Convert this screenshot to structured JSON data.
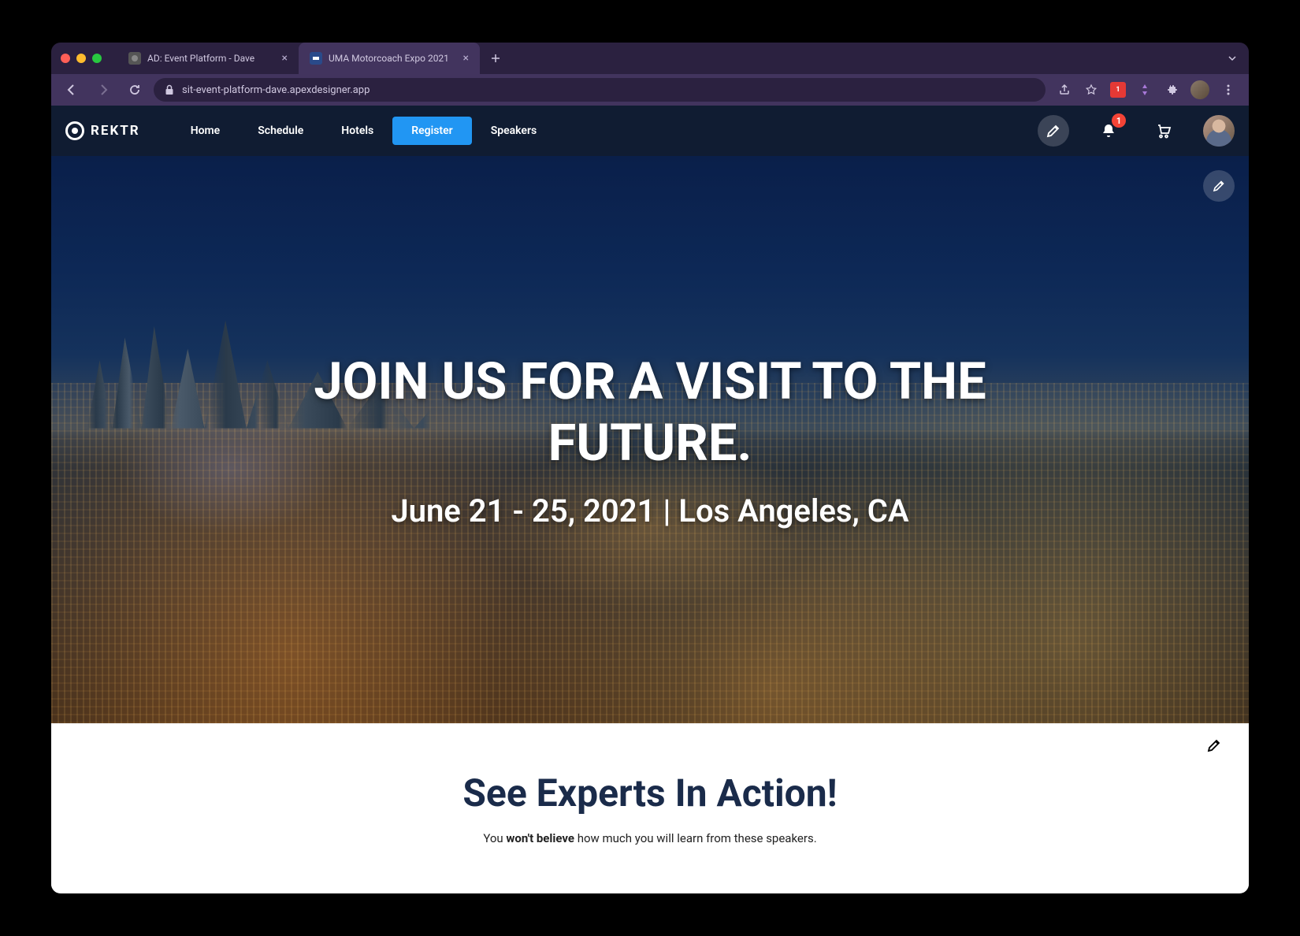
{
  "browser": {
    "tabs": [
      {
        "title": "AD: Event Platform - Dave",
        "active": false
      },
      {
        "title": "UMA Motorcoach Expo 2021",
        "active": true
      }
    ],
    "url": "sit-event-platform-dave.apexdesigner.app",
    "ext_badge": "1"
  },
  "nav": {
    "logo": "REKTR",
    "links": [
      {
        "label": "Home",
        "primary": false
      },
      {
        "label": "Schedule",
        "primary": false
      },
      {
        "label": "Hotels",
        "primary": false
      },
      {
        "label": "Register",
        "primary": true
      },
      {
        "label": "Speakers",
        "primary": false
      }
    ],
    "notif_count": "1"
  },
  "hero": {
    "title": "JOIN US FOR A VISIT TO THE FUTURE.",
    "subtitle": "June 21 - 25, 2021 | Los Angeles, CA"
  },
  "section": {
    "heading": "See Experts In Action!",
    "sub_pre": "You ",
    "sub_bold": "won't believe",
    "sub_post": " how much you will learn from these speakers."
  }
}
